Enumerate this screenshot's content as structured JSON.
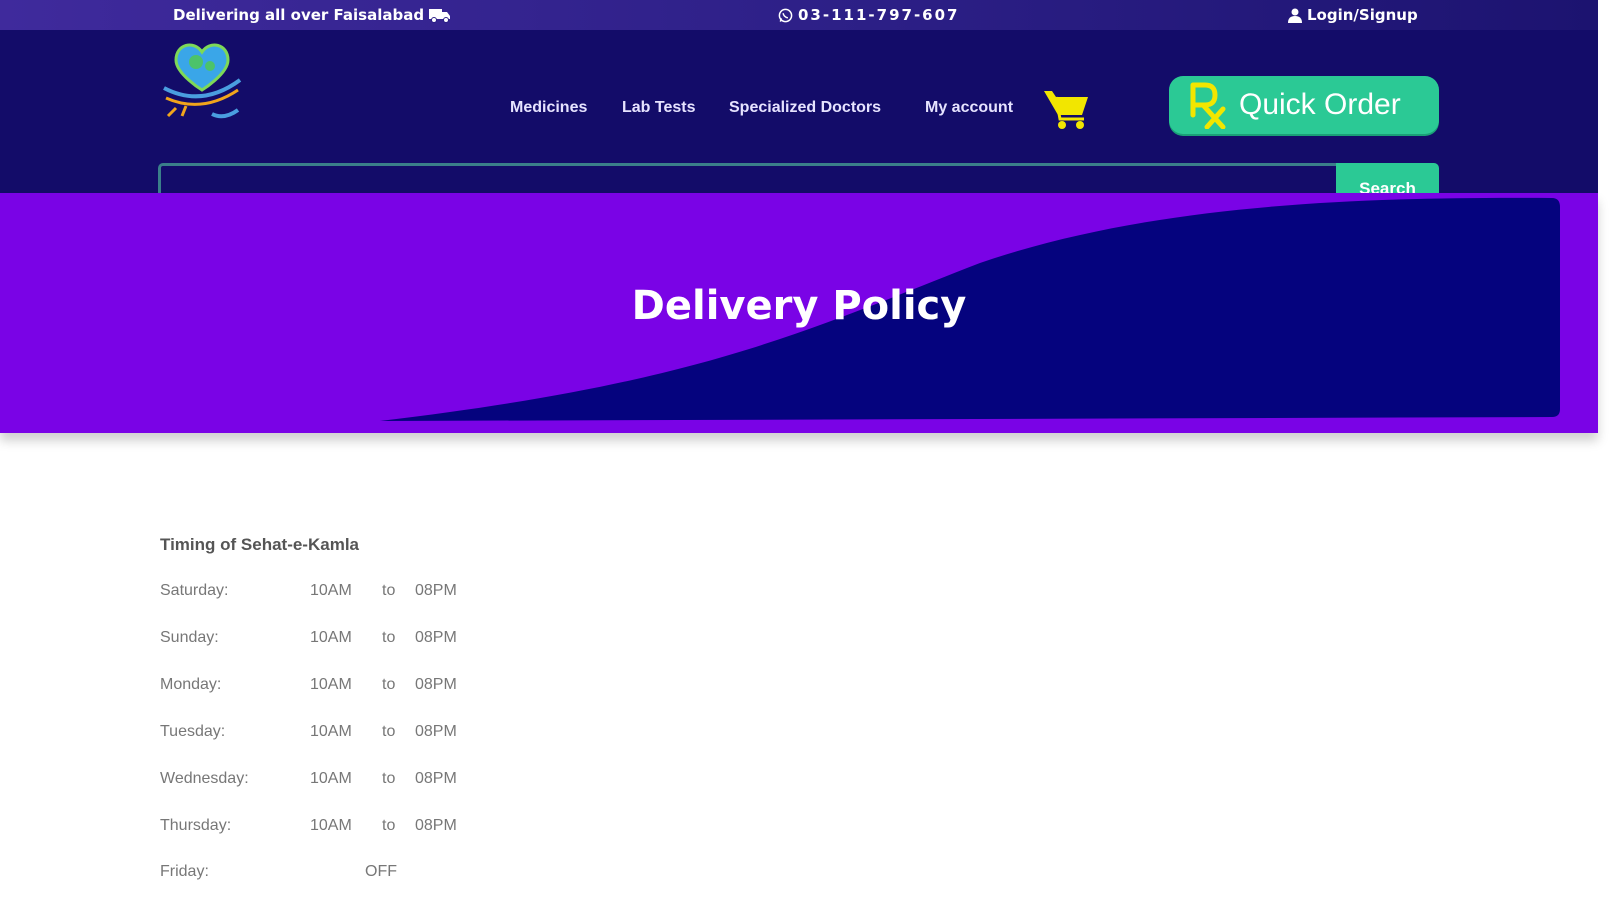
{
  "topbar": {
    "delivery_text": "Delivering all over Faisalabad",
    "phone": "03-111-797-607",
    "login_text": "Login/Signup"
  },
  "header": {
    "nav": [
      {
        "label": "Medicines"
      },
      {
        "label": "Lab Tests"
      },
      {
        "label": "Specialized Doctors"
      },
      {
        "label": "My account"
      }
    ],
    "quick_order_label": "Quick Order",
    "search_button_label": "Search",
    "search_value": ""
  },
  "hero": {
    "title": "Delivery Policy"
  },
  "timing": {
    "title": "Timing of Sehat-e-Kamla",
    "days": [
      {
        "day": "Saturday:",
        "open": "10AM",
        "sep": "to",
        "close": "08PM"
      },
      {
        "day": "Sunday:",
        "open": "10AM",
        "sep": "to",
        "close": "08PM"
      },
      {
        "day": "Monday:",
        "open": "10AM",
        "sep": "to",
        "close": "08PM"
      },
      {
        "day": "Tuesday:",
        "open": "10AM",
        "sep": "to",
        "close": "08PM"
      },
      {
        "day": "Wednesday:",
        "open": "10AM",
        "sep": "to",
        "close": "08PM"
      },
      {
        "day": "Thursday:",
        "open": "10AM",
        "sep": "to",
        "close": "08PM"
      }
    ],
    "friday": {
      "day": "Friday:",
      "status": "OFF"
    }
  },
  "colors": {
    "topbar": "#2c1f86",
    "header": "#130c69",
    "hero_purple": "#7a03e6",
    "hero_navy": "#05037e",
    "accent_green": "#2bc995",
    "cart_yellow": "#f2e600"
  }
}
